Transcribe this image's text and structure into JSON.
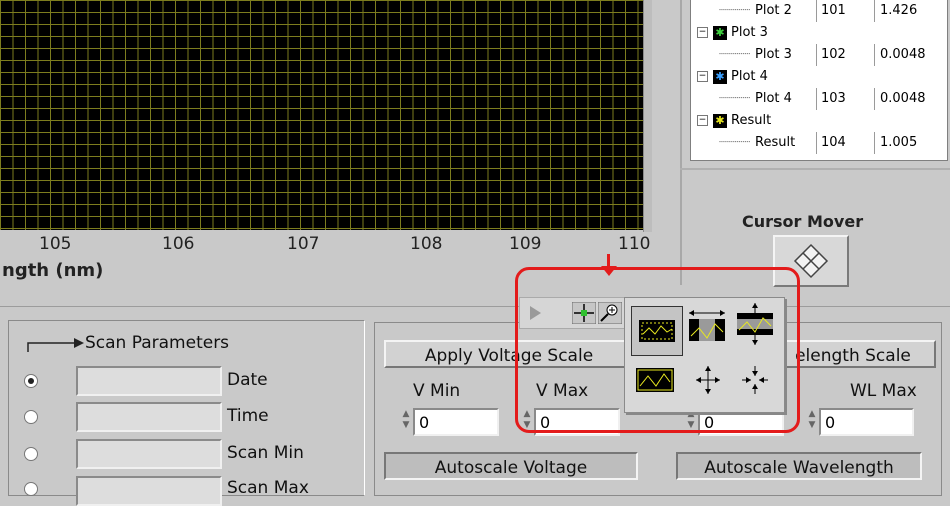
{
  "graph": {
    "x_ticks": [
      "105",
      "106",
      "107",
      "108",
      "109",
      "110"
    ],
    "x_label": "ngth (nm)",
    "grid_color": "#7d7d1e",
    "background": "#000000"
  },
  "tree": {
    "rows": [
      {
        "kind": "child",
        "name": "Plot 2",
        "id": "101",
        "value": "1.426"
      },
      {
        "kind": "parent",
        "name": "Plot 3",
        "color": "#3fd13f"
      },
      {
        "kind": "child",
        "name": "Plot 3",
        "id": "102",
        "value": "0.0048"
      },
      {
        "kind": "parent",
        "name": "Plot 4",
        "color": "#3aa0ff"
      },
      {
        "kind": "child",
        "name": "Plot 4",
        "id": "103",
        "value": "0.0048"
      },
      {
        "kind": "parent",
        "name": "Result",
        "color": "#e8e820"
      },
      {
        "kind": "child",
        "name": "Result",
        "id": "104",
        "value": "1.005"
      }
    ]
  },
  "cursor_mover": {
    "title": "Cursor Mover"
  },
  "scan": {
    "title": "Scan Parameters",
    "rows": [
      {
        "label": "Date",
        "selected": true
      },
      {
        "label": "Time",
        "selected": false
      },
      {
        "label": "Scan Min",
        "selected": false
      },
      {
        "label": "Scan Max",
        "selected": false
      }
    ]
  },
  "scale": {
    "apply_voltage": "Apply Voltage Scale",
    "apply_wavelength": "elength Scale",
    "vmin_label": "V Min",
    "vmax_label": "V Max",
    "wlmax_label": "WL Max",
    "vmin_value": "0",
    "vmax_value": "0",
    "wlmin_value": "0",
    "wlmax_value": "0",
    "autoscale_voltage": "Autoscale Voltage",
    "autoscale_wavelength": "Autoscale Wavelength"
  },
  "palette": {
    "tools": [
      "zoom-rectangle-icon",
      "zoom-x-icon",
      "zoom-y-icon",
      "zoom-fit-icon",
      "zoom-in-point-icon",
      "zoom-out-point-icon"
    ]
  },
  "accent": "#e31b1b"
}
